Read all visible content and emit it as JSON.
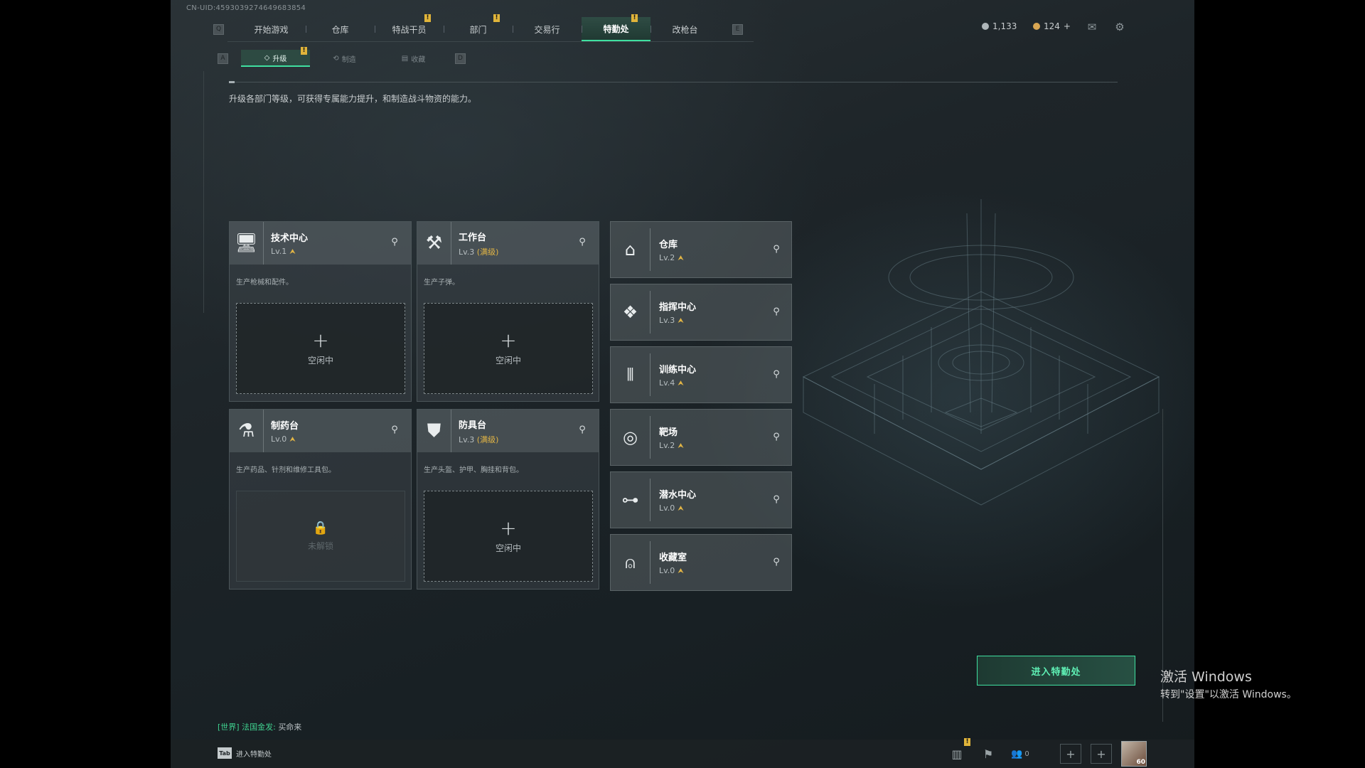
{
  "uid": "CN-UID:4593039274649683854",
  "nav": {
    "left_key": "Q",
    "right_key": "E",
    "tabs": [
      {
        "label": "开始游戏",
        "badge": ""
      },
      {
        "label": "仓库",
        "badge": ""
      },
      {
        "label": "特战干员",
        "badge": "!"
      },
      {
        "label": "部门",
        "badge": "!"
      },
      {
        "label": "交易行",
        "badge": ""
      },
      {
        "label": "特勤处",
        "badge": "!",
        "active": true
      },
      {
        "label": "改枪台",
        "badge": ""
      }
    ]
  },
  "subnav": {
    "left_key": "A",
    "right_key": "D",
    "tabs": [
      {
        "label": "升级",
        "badge": "!",
        "active": true
      },
      {
        "label": "制造",
        "badge": ""
      },
      {
        "label": "收藏",
        "badge": ""
      }
    ]
  },
  "resources": {
    "coin_silver": "1,133",
    "coin_gold": "124",
    "add_label": "+"
  },
  "description": "升级各部门等级，可获得专属能力提升，和制造战斗物资的能力。",
  "big_cards": [
    {
      "name": "技术中心",
      "level": "Lv.1",
      "max": "",
      "sub": "生产枪械和配件。",
      "slot": "空闲中",
      "locked": false,
      "icon": "monitor-icon"
    },
    {
      "name": "工作台",
      "level": "Lv.3",
      "max": "(满级)",
      "sub": "生产子弹。",
      "slot": "空闲中",
      "locked": false,
      "icon": "hammer-wrench-icon"
    },
    {
      "name": "制药台",
      "level": "Lv.0",
      "max": "",
      "sub": "生产药品、针剂和维修工具包。",
      "slot": "未解锁",
      "locked": true,
      "icon": "microscope-icon"
    },
    {
      "name": "防具台",
      "level": "Lv.3",
      "max": "(满级)",
      "sub": "生产头盔、护甲、胸挂和背包。",
      "slot": "空闲中",
      "locked": false,
      "icon": "armor-icon"
    }
  ],
  "list_cards": [
    {
      "name": "仓库",
      "level": "Lv.2",
      "icon": "warehouse-icon"
    },
    {
      "name": "指挥中心",
      "level": "Lv.3",
      "icon": "command-icon"
    },
    {
      "name": "训练中心",
      "level": "Lv.4",
      "icon": "dumbbell-icon"
    },
    {
      "name": "靶场",
      "level": "Lv.2",
      "icon": "target-icon"
    },
    {
      "name": "潜水中心",
      "level": "Lv.0",
      "icon": "diving-mask-icon"
    },
    {
      "name": "收藏室",
      "level": "Lv.0",
      "icon": "trophy-case-icon"
    }
  ],
  "enter_button": "进入特勤处",
  "chat": {
    "channel": "[世界]",
    "sender": "法国金发:",
    "message": "买命来"
  },
  "bottom": {
    "tab_key": "Tab",
    "tab_label": "进入特勤处",
    "friends_count": "0",
    "avatar_level": "60",
    "badge": "!"
  },
  "watermark": {
    "line1": "激活 Windows",
    "line2": "转到\"设置\"以激活 Windows。"
  },
  "colors": {
    "accent": "#3fe0a0",
    "badge": "#e0b43a",
    "max_level": "#e2b545"
  }
}
